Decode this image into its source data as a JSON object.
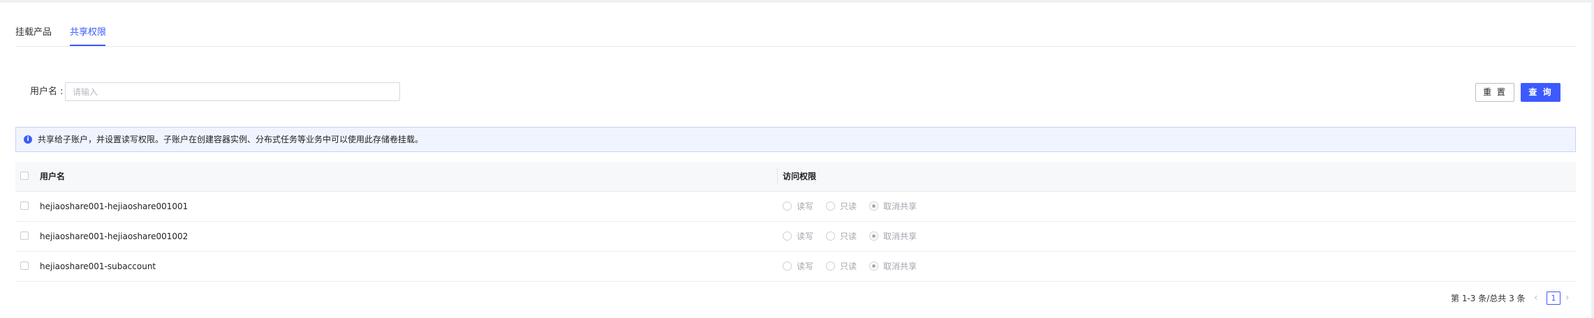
{
  "tabs": [
    {
      "label": "挂载产品",
      "active": false
    },
    {
      "label": "共享权限",
      "active": true
    }
  ],
  "search": {
    "label": "用户名 :",
    "placeholder": "请输入",
    "value": ""
  },
  "buttons": {
    "reset": "重 置",
    "query": "查 询"
  },
  "notice": {
    "icon": "info-icon",
    "text": "共享给子账户，并设置读写权限。子账户在创建容器实例、分布式任务等业务中可以使用此存储卷挂载。"
  },
  "table": {
    "columns": [
      "用户名",
      "访问权限"
    ],
    "permission_options": [
      "读写",
      "只读",
      "取消共享"
    ],
    "rows": [
      {
        "username": "hejiaoshare001-hejiaoshare001001",
        "permission": "取消共享"
      },
      {
        "username": "hejiaoshare001-hejiaoshare001002",
        "permission": "取消共享"
      },
      {
        "username": "hejiaoshare001-subaccount",
        "permission": "取消共享"
      }
    ]
  },
  "pagination": {
    "summary": "第 1-3 条/总共 3 条",
    "current_page": "1",
    "prev_icon": "chevron-left-icon",
    "next_icon": "chevron-right-icon"
  },
  "colors": {
    "accent": "#3d5afe",
    "notice_bg": "#f0f4ff",
    "notice_border": "#c7d2fb"
  }
}
